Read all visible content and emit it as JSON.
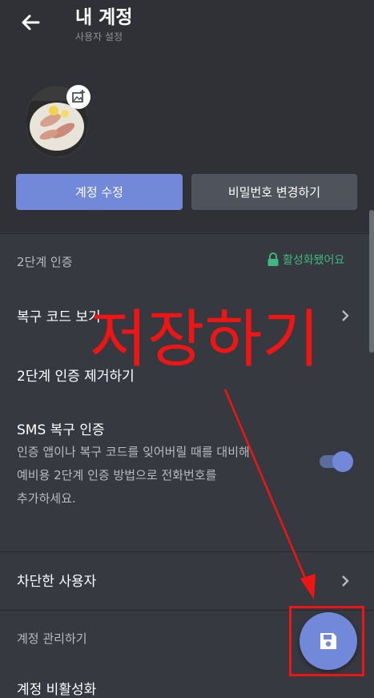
{
  "header": {
    "title": "내 계정",
    "subtitle": "사용자 설정"
  },
  "buttons": {
    "edit_account": "계정 수정",
    "change_password": "비밀번호 변경하기"
  },
  "two_factor": {
    "header": "2단계 인증",
    "status": "활성화됐어요",
    "status_color": "#43b581",
    "view_backup_codes": "복구 코드 보기",
    "remove_2fa": "2단계 인증 제거하기",
    "sms_title": "SMS 복구 인증",
    "sms_desc_line1": "인증 앱이나 복구 코드를 잊어버릴 때를 대비해",
    "sms_desc_line2": "예비용 2단계 인증 방법으로 전화번호를",
    "sms_desc_line3": "추가하세요.",
    "sms_enabled": true
  },
  "blocked_users": "차단한 사용자",
  "account_management": {
    "header": "계정 관리하기",
    "next_item": "계정 비활성화"
  },
  "annotation": {
    "text": "저장하기",
    "color": "#f01515"
  },
  "accent": "#7289da"
}
